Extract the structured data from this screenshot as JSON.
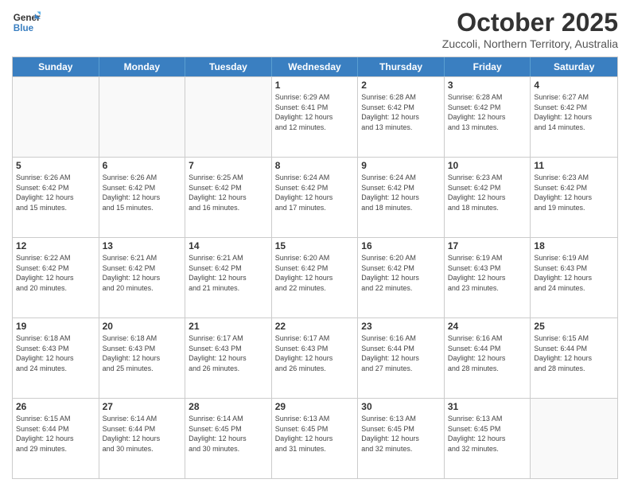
{
  "logo": {
    "line1": "General",
    "line2": "Blue"
  },
  "title": "October 2025",
  "subtitle": "Zuccoli, Northern Territory, Australia",
  "days": [
    "Sunday",
    "Monday",
    "Tuesday",
    "Wednesday",
    "Thursday",
    "Friday",
    "Saturday"
  ],
  "rows": [
    [
      {
        "day": "",
        "info": ""
      },
      {
        "day": "",
        "info": ""
      },
      {
        "day": "",
        "info": ""
      },
      {
        "day": "1",
        "info": "Sunrise: 6:29 AM\nSunset: 6:41 PM\nDaylight: 12 hours\nand 12 minutes."
      },
      {
        "day": "2",
        "info": "Sunrise: 6:28 AM\nSunset: 6:42 PM\nDaylight: 12 hours\nand 13 minutes."
      },
      {
        "day": "3",
        "info": "Sunrise: 6:28 AM\nSunset: 6:42 PM\nDaylight: 12 hours\nand 13 minutes."
      },
      {
        "day": "4",
        "info": "Sunrise: 6:27 AM\nSunset: 6:42 PM\nDaylight: 12 hours\nand 14 minutes."
      }
    ],
    [
      {
        "day": "5",
        "info": "Sunrise: 6:26 AM\nSunset: 6:42 PM\nDaylight: 12 hours\nand 15 minutes."
      },
      {
        "day": "6",
        "info": "Sunrise: 6:26 AM\nSunset: 6:42 PM\nDaylight: 12 hours\nand 15 minutes."
      },
      {
        "day": "7",
        "info": "Sunrise: 6:25 AM\nSunset: 6:42 PM\nDaylight: 12 hours\nand 16 minutes."
      },
      {
        "day": "8",
        "info": "Sunrise: 6:24 AM\nSunset: 6:42 PM\nDaylight: 12 hours\nand 17 minutes."
      },
      {
        "day": "9",
        "info": "Sunrise: 6:24 AM\nSunset: 6:42 PM\nDaylight: 12 hours\nand 18 minutes."
      },
      {
        "day": "10",
        "info": "Sunrise: 6:23 AM\nSunset: 6:42 PM\nDaylight: 12 hours\nand 18 minutes."
      },
      {
        "day": "11",
        "info": "Sunrise: 6:23 AM\nSunset: 6:42 PM\nDaylight: 12 hours\nand 19 minutes."
      }
    ],
    [
      {
        "day": "12",
        "info": "Sunrise: 6:22 AM\nSunset: 6:42 PM\nDaylight: 12 hours\nand 20 minutes."
      },
      {
        "day": "13",
        "info": "Sunrise: 6:21 AM\nSunset: 6:42 PM\nDaylight: 12 hours\nand 20 minutes."
      },
      {
        "day": "14",
        "info": "Sunrise: 6:21 AM\nSunset: 6:42 PM\nDaylight: 12 hours\nand 21 minutes."
      },
      {
        "day": "15",
        "info": "Sunrise: 6:20 AM\nSunset: 6:42 PM\nDaylight: 12 hours\nand 22 minutes."
      },
      {
        "day": "16",
        "info": "Sunrise: 6:20 AM\nSunset: 6:42 PM\nDaylight: 12 hours\nand 22 minutes."
      },
      {
        "day": "17",
        "info": "Sunrise: 6:19 AM\nSunset: 6:43 PM\nDaylight: 12 hours\nand 23 minutes."
      },
      {
        "day": "18",
        "info": "Sunrise: 6:19 AM\nSunset: 6:43 PM\nDaylight: 12 hours\nand 24 minutes."
      }
    ],
    [
      {
        "day": "19",
        "info": "Sunrise: 6:18 AM\nSunset: 6:43 PM\nDaylight: 12 hours\nand 24 minutes."
      },
      {
        "day": "20",
        "info": "Sunrise: 6:18 AM\nSunset: 6:43 PM\nDaylight: 12 hours\nand 25 minutes."
      },
      {
        "day": "21",
        "info": "Sunrise: 6:17 AM\nSunset: 6:43 PM\nDaylight: 12 hours\nand 26 minutes."
      },
      {
        "day": "22",
        "info": "Sunrise: 6:17 AM\nSunset: 6:43 PM\nDaylight: 12 hours\nand 26 minutes."
      },
      {
        "day": "23",
        "info": "Sunrise: 6:16 AM\nSunset: 6:44 PM\nDaylight: 12 hours\nand 27 minutes."
      },
      {
        "day": "24",
        "info": "Sunrise: 6:16 AM\nSunset: 6:44 PM\nDaylight: 12 hours\nand 28 minutes."
      },
      {
        "day": "25",
        "info": "Sunrise: 6:15 AM\nSunset: 6:44 PM\nDaylight: 12 hours\nand 28 minutes."
      }
    ],
    [
      {
        "day": "26",
        "info": "Sunrise: 6:15 AM\nSunset: 6:44 PM\nDaylight: 12 hours\nand 29 minutes."
      },
      {
        "day": "27",
        "info": "Sunrise: 6:14 AM\nSunset: 6:44 PM\nDaylight: 12 hours\nand 30 minutes."
      },
      {
        "day": "28",
        "info": "Sunrise: 6:14 AM\nSunset: 6:45 PM\nDaylight: 12 hours\nand 30 minutes."
      },
      {
        "day": "29",
        "info": "Sunrise: 6:13 AM\nSunset: 6:45 PM\nDaylight: 12 hours\nand 31 minutes."
      },
      {
        "day": "30",
        "info": "Sunrise: 6:13 AM\nSunset: 6:45 PM\nDaylight: 12 hours\nand 32 minutes."
      },
      {
        "day": "31",
        "info": "Sunrise: 6:13 AM\nSunset: 6:45 PM\nDaylight: 12 hours\nand 32 minutes."
      },
      {
        "day": "",
        "info": ""
      }
    ]
  ]
}
